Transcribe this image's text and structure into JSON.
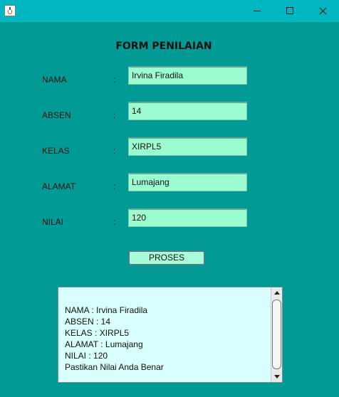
{
  "window": {
    "title": "",
    "controls": [
      "minimize-icon",
      "maximize-icon",
      "close-icon"
    ]
  },
  "form": {
    "title": "FORM PENILAIAN",
    "colon": ":",
    "fields": [
      {
        "label": "NAMA",
        "value": "Irvina Firadila"
      },
      {
        "label": "ABSEN",
        "value": "14"
      },
      {
        "label": "KELAS",
        "value": "XIRPL5"
      },
      {
        "label": "ALAMAT",
        "value": "Lumajang"
      },
      {
        "label": "NILAI",
        "value": "120"
      }
    ],
    "button_label": "PROSES"
  },
  "output": {
    "lines": [
      "NAMA : Irvina Firadila",
      "ABSEN : 14",
      "KELAS : XIRPL5",
      "ALAMAT : Lumajang",
      "NILAI : 120",
      "Pastikan Nilai Anda Benar"
    ]
  },
  "colors": {
    "background": "#029a95",
    "titlebar": "#00b6c1",
    "field_bg": "#9bfcd0",
    "output_bg": "#d8fffe"
  }
}
